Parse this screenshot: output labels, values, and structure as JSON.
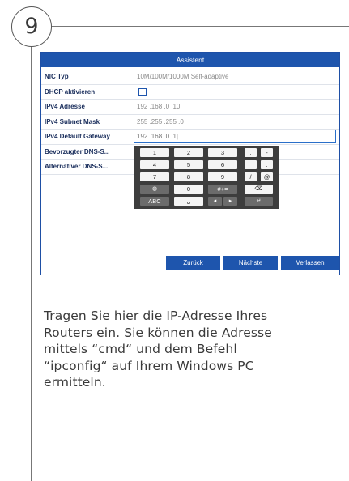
{
  "step": {
    "number": "9"
  },
  "dialog": {
    "title": "Assistent",
    "fields": [
      {
        "label": "NIC Typ",
        "value": "10M/100M/1000M Self-adaptive"
      },
      {
        "label": "DHCP aktivieren",
        "value": ""
      },
      {
        "label": "IPv4 Adresse",
        "value": "192 .168 .0    .10"
      },
      {
        "label": "IPv4 Subnet Mask",
        "value": "255 .255 .255 .0"
      },
      {
        "label": "IPv4 Default Gateway",
        "value": "192 .168 .0    .1|"
      },
      {
        "label": "Bevorzugter DNS-S...",
        "value": ""
      },
      {
        "label": "Alternativer DNS-S...",
        "value": ""
      },
      {
        "label": "",
        "value": ""
      }
    ],
    "keyboard": {
      "row1": [
        "1",
        "2",
        "3",
        ".",
        "-"
      ],
      "row2": [
        "4",
        "5",
        "6",
        "_",
        ":"
      ],
      "row3": [
        "7",
        "8",
        "9",
        "/",
        "@"
      ],
      "row4": [
        "◍",
        "0",
        "#+=",
        "⌫"
      ],
      "row5": [
        "ABC",
        "␣",
        "◂",
        "▸",
        "↵"
      ]
    },
    "buttons": {
      "back": "Zurück",
      "next": "Nächste",
      "exit": "Verlassen"
    }
  },
  "description": {
    "lines": [
      "Tragen Sie hier die IP-Adresse Ihres",
      "Routers ein. Sie können die Adresse",
      "mittels “cmd“ und dem Befehl",
      "“ipconfig“ auf Ihrem Windows PC",
      "ermitteln."
    ]
  }
}
